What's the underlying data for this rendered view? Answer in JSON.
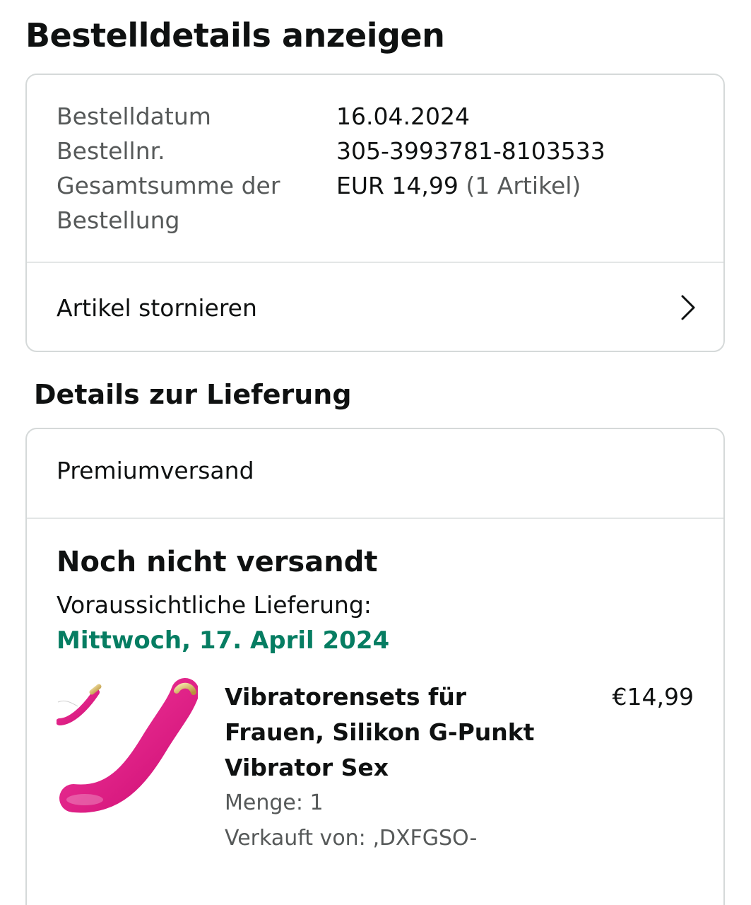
{
  "page": {
    "title": "Bestelldetails anzeigen"
  },
  "summary": {
    "rows": [
      {
        "label": "Bestelldatum",
        "value": "16.04.2024",
        "extra": ""
      },
      {
        "label": "Bestellnr.",
        "value": "305-3993781-8103533",
        "extra": ""
      },
      {
        "label": "Gesamtsumme der Bestellung",
        "value": "EUR 14,99",
        "extra": "(1 Artikel)"
      }
    ],
    "cancel_label": "Artikel stornieren"
  },
  "delivery": {
    "section_title": "Details zur Lieferung",
    "shipping_type": "Premiumversand",
    "status": "Noch nicht versandt",
    "eta_label": "Voraussichtliche Lieferung:",
    "eta_date": "Mittwoch, 17. April 2024",
    "eta_color": "#067d62",
    "item": {
      "title": "Vibratorensets für Frauen, Silikon G-Punkt Vibrator Sex",
      "quantity": "Menge: 1",
      "seller": "Verkauft von: ‚DXFGSO-",
      "price": "€14,99",
      "image_icon": "product-image",
      "product_color": "#e0157d"
    }
  }
}
